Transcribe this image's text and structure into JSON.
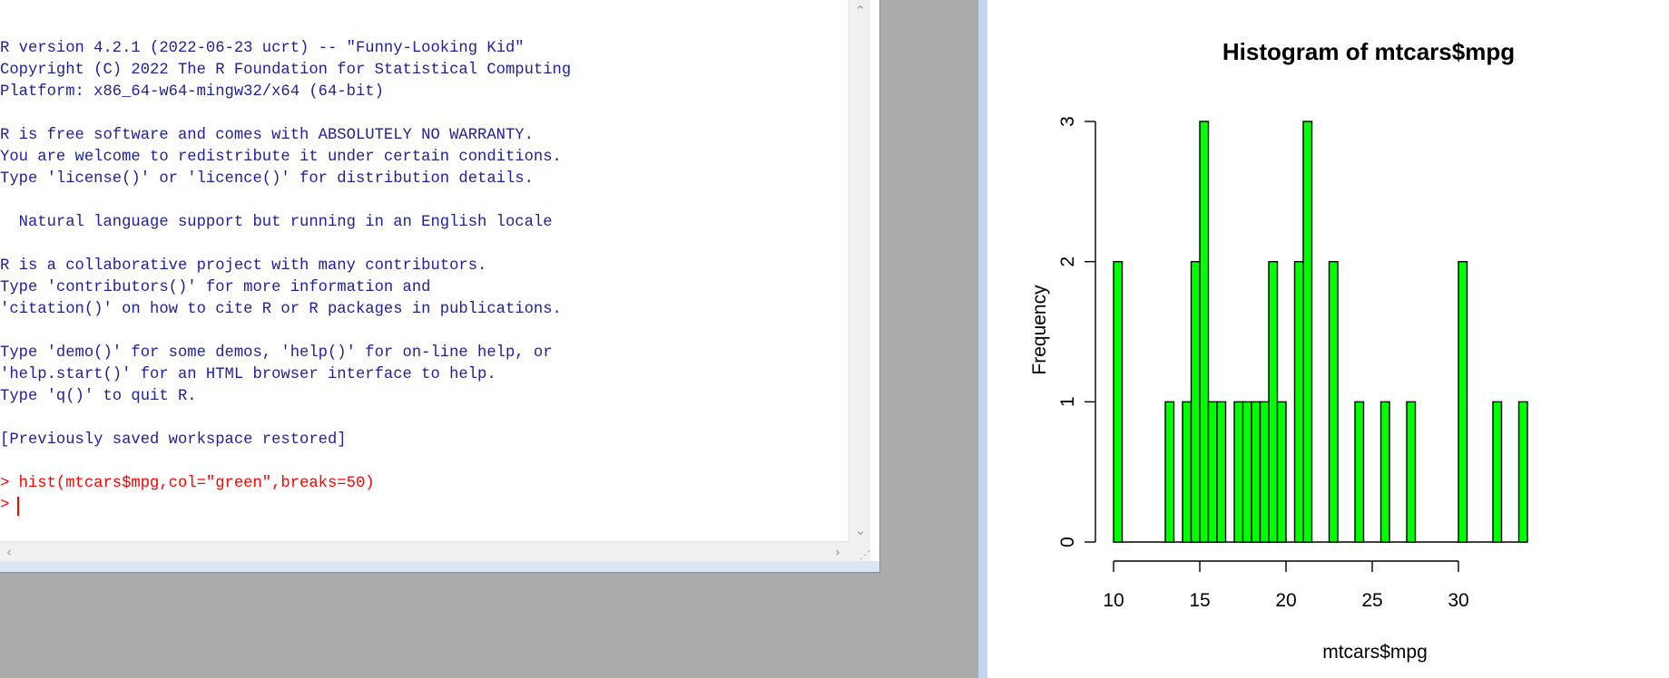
{
  "console": {
    "lines": [
      "R version 4.2.1 (2022-06-23 ucrt) -- \"Funny-Looking Kid\"",
      "Copyright (C) 2022 The R Foundation for Statistical Computing",
      "Platform: x86_64-w64-mingw32/x64 (64-bit)",
      "",
      "R is free software and comes with ABSOLUTELY NO WARRANTY.",
      "You are welcome to redistribute it under certain conditions.",
      "Type 'license()' or 'licence()' for distribution details.",
      "",
      "  Natural language support but running in an English locale",
      "",
      "R is a collaborative project with many contributors.",
      "Type 'contributors()' for more information and",
      "'citation()' on how to cite R or R packages in publications.",
      "",
      "Type 'demo()' for some demos, 'help()' for on-line help, or",
      "'help.start()' for an HTML browser interface to help.",
      "Type 'q()' to quit R.",
      "",
      "[Previously saved workspace restored]",
      ""
    ],
    "command_line": "> hist(mtcars$mpg,col=\"green\",breaks=50)",
    "prompt": "> ",
    "text_color": "#1f1f9c",
    "command_color": "#ff0000"
  },
  "chart_data": {
    "type": "bar",
    "title": "Histogram of mtcars$mpg",
    "xlabel": "mtcars$mpg",
    "ylabel": "Frequency",
    "bar_color": "#00ff00",
    "bin_width": 0.5,
    "bins": [
      {
        "x0": 10.0,
        "count": 2
      },
      {
        "x0": 13.0,
        "count": 1
      },
      {
        "x0": 14.0,
        "count": 1
      },
      {
        "x0": 14.5,
        "count": 2
      },
      {
        "x0": 15.0,
        "count": 3
      },
      {
        "x0": 15.5,
        "count": 1
      },
      {
        "x0": 16.0,
        "count": 1
      },
      {
        "x0": 17.0,
        "count": 1
      },
      {
        "x0": 17.5,
        "count": 1
      },
      {
        "x0": 18.0,
        "count": 1
      },
      {
        "x0": 18.5,
        "count": 1
      },
      {
        "x0": 19.0,
        "count": 2
      },
      {
        "x0": 19.5,
        "count": 1
      },
      {
        "x0": 20.5,
        "count": 2
      },
      {
        "x0": 21.0,
        "count": 3
      },
      {
        "x0": 22.5,
        "count": 2
      },
      {
        "x0": 24.0,
        "count": 1
      },
      {
        "x0": 25.5,
        "count": 1
      },
      {
        "x0": 27.0,
        "count": 1
      },
      {
        "x0": 30.0,
        "count": 2
      },
      {
        "x0": 32.0,
        "count": 1
      },
      {
        "x0": 33.5,
        "count": 1
      }
    ],
    "xlim": [
      10,
      34
    ],
    "ylim": [
      0,
      3
    ],
    "x_ticks": [
      "10",
      "15",
      "20",
      "25",
      "30"
    ],
    "y_ticks": [
      "0",
      "1",
      "2",
      "3"
    ],
    "grid": false
  }
}
